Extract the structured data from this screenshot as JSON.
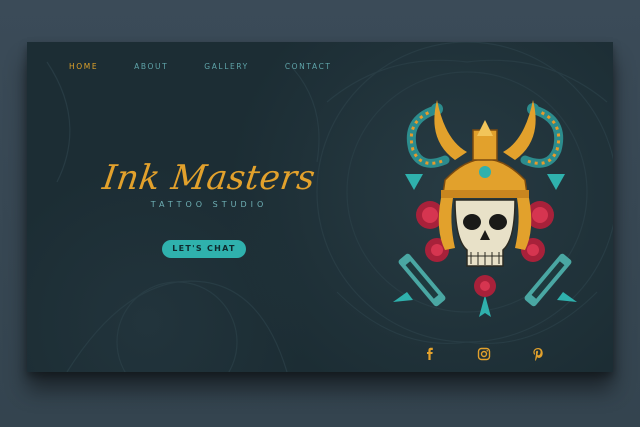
{
  "nav": {
    "items": [
      {
        "label": "HOME",
        "active": true
      },
      {
        "label": "ABOUT",
        "active": false
      },
      {
        "label": "GALLERY",
        "active": false
      },
      {
        "label": "CONTACT",
        "active": false
      }
    ]
  },
  "hero": {
    "title": "Ink Masters",
    "subtitle": "TATTOO STUDIO",
    "cta_label": "LET'S CHAT"
  },
  "illustration": {
    "subject": "samurai-skull-icon"
  },
  "social": {
    "icons": [
      "facebook-icon",
      "instagram-icon",
      "pinterest-icon"
    ]
  },
  "colors": {
    "background": "#1c2d34",
    "accent_gold": "#e2a12c",
    "accent_teal": "#2fb1ad",
    "nav_text": "#5fa4a9"
  }
}
